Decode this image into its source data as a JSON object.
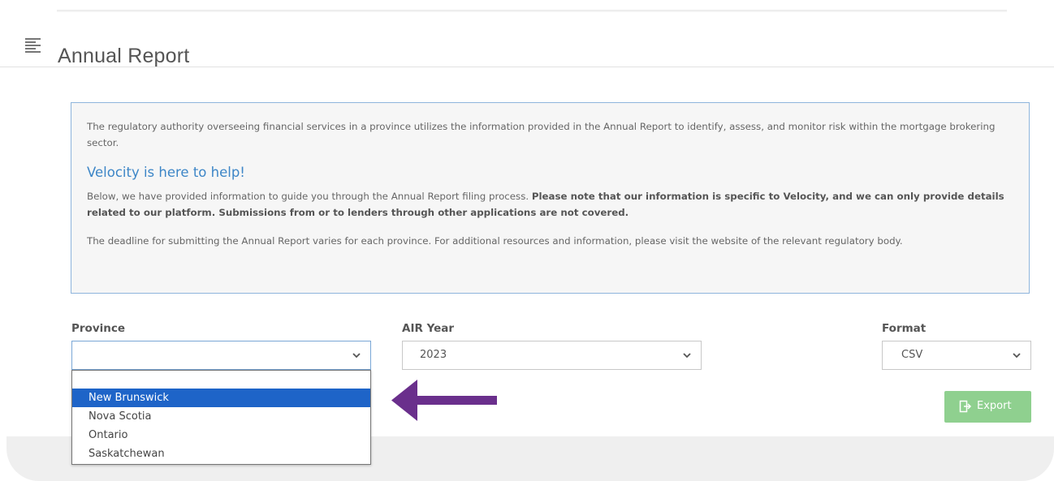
{
  "header": {
    "title": "Annual Report",
    "menu_icon": "hamburger-menu-icon"
  },
  "info": {
    "paragraph1": "The regulatory authority overseeing financial services in a province utilizes the information provided in the Annual Report to identify, assess, and monitor risk within the mortgage brokering sector.",
    "help_title": "Velocity is here to help!",
    "paragraph2_normal": "Below, we have provided information to guide you through the Annual Report filing process. ",
    "paragraph2_bold": "Please note that our information is specific to Velocity, and we can only provide details related to our platform. Submissions from or to lenders through other applications are not covered.",
    "paragraph3": "The deadline for submitting the Annual Report varies for each province. For additional resources and information, please visit the website of the relevant regulatory body."
  },
  "form": {
    "province": {
      "label": "Province",
      "value": ""
    },
    "air_year": {
      "label": "AIR Year",
      "value": "2023"
    },
    "format": {
      "label": "Format",
      "value": "CSV"
    }
  },
  "province_options": {
    "blank": "",
    "items": [
      "New Brunswick",
      "Nova Scotia",
      "Ontario",
      "Saskatchewan"
    ],
    "highlighted": "New Brunswick"
  },
  "export_button": {
    "label": "Export",
    "icon": "export-icon"
  },
  "colors": {
    "accent": "#3d86c7",
    "highlight": "#1e64c8",
    "export": "#8fd08f",
    "arrow": "#6a2f8c"
  }
}
